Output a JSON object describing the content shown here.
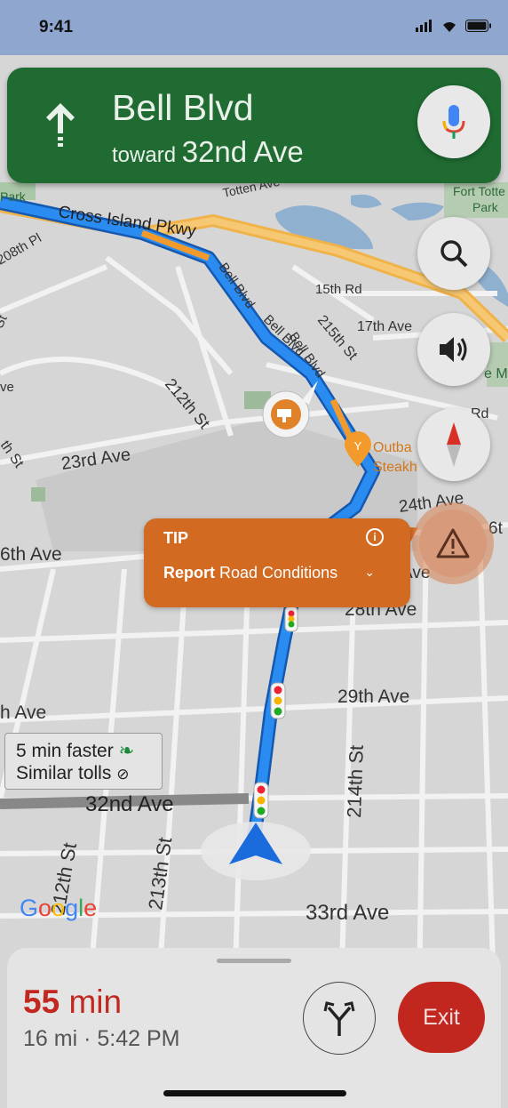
{
  "status_bar": {
    "time": "9:41"
  },
  "nav_banner": {
    "street": "Bell Blvd",
    "toward_label": "toward",
    "toward_street": "32nd Ave"
  },
  "map_labels": {
    "park": "Park",
    "totten_ave": "Totten Ave",
    "fort_totten_park_1": "Fort Totte",
    "fort_totten_park_2": "Park",
    "cross_island_pkwy": "Cross Island Pkwy",
    "pl_208th": "208th Pl",
    "st_left_1": "St",
    "ave_left_1": "ve",
    "th_st_left": "th St",
    "bell_blvd_1": "Bell Blvd",
    "bell_blvd_2": "Bell Blvd",
    "bell_blvd_3": "Bell Blvd",
    "rd_15th": "15th Rd",
    "st_215th": "215th St",
    "ave_17th": "17th Ave",
    "mi": "e Mi",
    "rd_right": "Rd",
    "st_212th": "212th St",
    "ave_23rd": "23rd Ave",
    "outback_1": "Outba",
    "outback_2": "Steakh",
    "ave_24th": "24th Ave",
    "ave_26th": "6th Ave",
    "ave_right_26": "6t",
    "ave_ave": "Ave",
    "ave_28th": "28th Ave",
    "ave_29th": "29th Ave",
    "ave_left_h": "h Ave",
    "ave_32nd": "32nd Ave",
    "st_212th_b": "212th St",
    "st_213th": "213th St",
    "st_214th": "214th St",
    "ave_33rd": "33rd Ave",
    "ve_right": "e"
  },
  "tip": {
    "title": "TIP",
    "info": "i",
    "action_bold": "Report",
    "action_text": "Road Conditions"
  },
  "route_badge": {
    "line1": "5 min faster",
    "line2": "Similar tolls"
  },
  "google_logo": "Google",
  "colors": {
    "banner": "#1f6b32",
    "tip": "#d26a22",
    "eta": "#c1281f",
    "route": "#1a73e8",
    "exit": "#c1271f"
  },
  "bottom_sheet": {
    "eta_value": "55",
    "eta_unit": "min",
    "distance": "16 mi",
    "arrival": "5:42 PM",
    "separator": "·",
    "exit_label": "Exit"
  },
  "icons": {
    "banner_arrow": "arrow-up-icon",
    "mic": "microphone-icon",
    "search": "search-icon",
    "sound": "volume-icon",
    "compass": "compass-icon",
    "hazard": "warning-icon",
    "routes": "alternate-routes-icon"
  }
}
